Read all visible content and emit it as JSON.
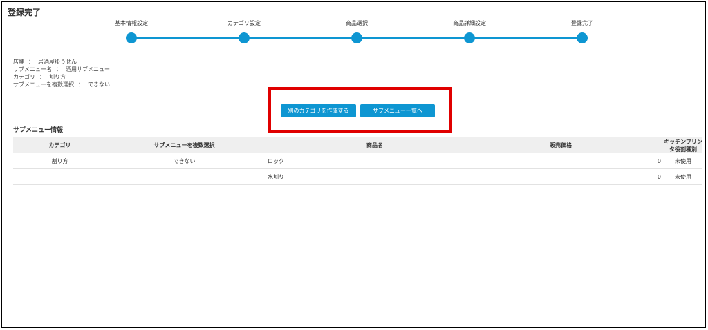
{
  "page": {
    "title": "登録完了"
  },
  "stepper": {
    "steps": [
      {
        "label": "基本情報設定"
      },
      {
        "label": "カテゴリ設定"
      },
      {
        "label": "商品選択"
      },
      {
        "label": "商品詳細設定"
      },
      {
        "label": "登録完了"
      }
    ],
    "accent": "#0e96d2"
  },
  "summary": [
    {
      "key": "店舗",
      "sep": "：",
      "value": "居酒屋ゆうせん"
    },
    {
      "key": "サブメニュー名",
      "sep": "：",
      "value": "酒用サブメニュー"
    },
    {
      "key": "カテゴリ",
      "sep": "：",
      "value": "割り方"
    },
    {
      "key": "サブメニューを複数選択",
      "sep": "：",
      "value": "できない"
    }
  ],
  "buttons": {
    "create_other": "別のカテゴリを作成する",
    "to_list": "サブメニュー一覧へ"
  },
  "highlight_color": "#e00000",
  "section": {
    "title": "サブメニュー情報"
  },
  "table": {
    "headers": [
      "カテゴリ",
      "サブメニューを複数選択",
      "商品名",
      "販売価格",
      "キッチンプリンタ役割種別"
    ],
    "rows": [
      [
        "割り方",
        "できない",
        "ロック",
        "0",
        "未使用"
      ],
      [
        "",
        "",
        "水割り",
        "0",
        "未使用"
      ]
    ]
  }
}
